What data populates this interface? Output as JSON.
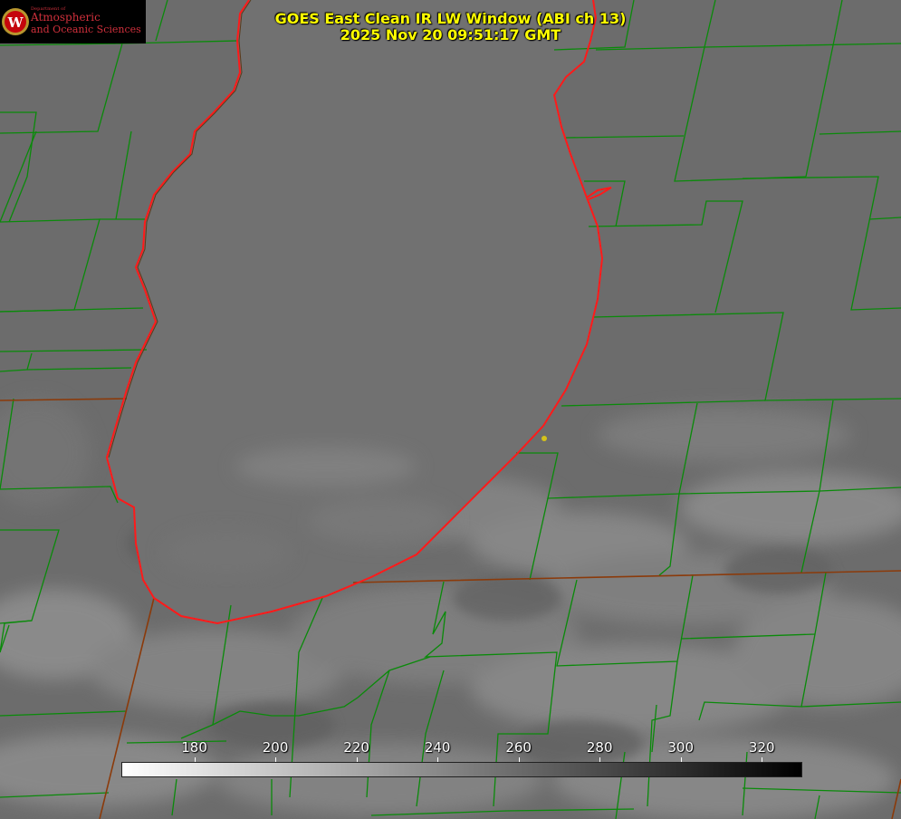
{
  "title": {
    "line1": "GOES East Clean IR LW Window (ABI ch 13)",
    "line2": "2025 Nov 20 09:51:17 GMT"
  },
  "logo": {
    "dept": "Department of",
    "line1": "Atmospheric",
    "line2": "and Oceanic Sciences",
    "mark": "W"
  },
  "colorbar": {
    "ticks": [
      "180",
      "200",
      "220",
      "240",
      "260",
      "280",
      "300",
      "320"
    ],
    "values": [
      180,
      200,
      220,
      240,
      260,
      280,
      300,
      320
    ],
    "range": [
      162,
      330
    ],
    "start_color": "#ffffff",
    "end_color": "#000000"
  },
  "colors": {
    "lake": "#707070",
    "land": "#6e6e6e",
    "county_lines": "#0a8a0a",
    "state_lines": "#8b3a0a",
    "shoreline": "#ff1a1a",
    "marker": "#d4c21a"
  }
}
